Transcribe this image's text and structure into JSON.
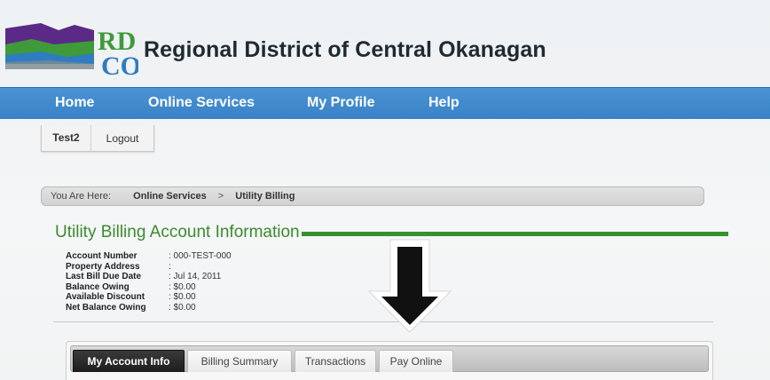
{
  "header": {
    "logo_text": "RD CO",
    "site_title": "Regional District of Central Okanagan"
  },
  "nav": {
    "items": [
      {
        "label": "Home"
      },
      {
        "label": "Online Services"
      },
      {
        "label": "My Profile"
      },
      {
        "label": "Help"
      }
    ]
  },
  "user": {
    "name": "Test2",
    "logout_label": "Logout"
  },
  "breadcrumb": {
    "prefix": "You Are Here:",
    "items": [
      "Online Services",
      "Utility Billing"
    ],
    "separator": ">"
  },
  "section": {
    "title": "Utility Billing Account Information"
  },
  "account_info": {
    "rows": [
      {
        "label": "Account Number",
        "value": ": 000-TEST-000"
      },
      {
        "label": "Property Address",
        "value": ":"
      },
      {
        "label": "Last Bill Due Date",
        "value": ": Jul 14, 2011"
      },
      {
        "label": "Balance Owing",
        "value": ": $0.00"
      },
      {
        "label": "Available Discount",
        "value": ": $0.00"
      },
      {
        "label": "Net Balance Owing",
        "value": ": $0.00"
      }
    ]
  },
  "tabs": {
    "items": [
      {
        "label": "My Account Info",
        "active": true
      },
      {
        "label": "Billing Summary",
        "active": false
      },
      {
        "label": "Transactions",
        "active": false
      },
      {
        "label": "Pay Online",
        "active": false
      }
    ]
  },
  "colors": {
    "nav_blue": "#3a82c6",
    "title_green": "#3d8a2e",
    "active_tab": "#1d1d1d"
  }
}
